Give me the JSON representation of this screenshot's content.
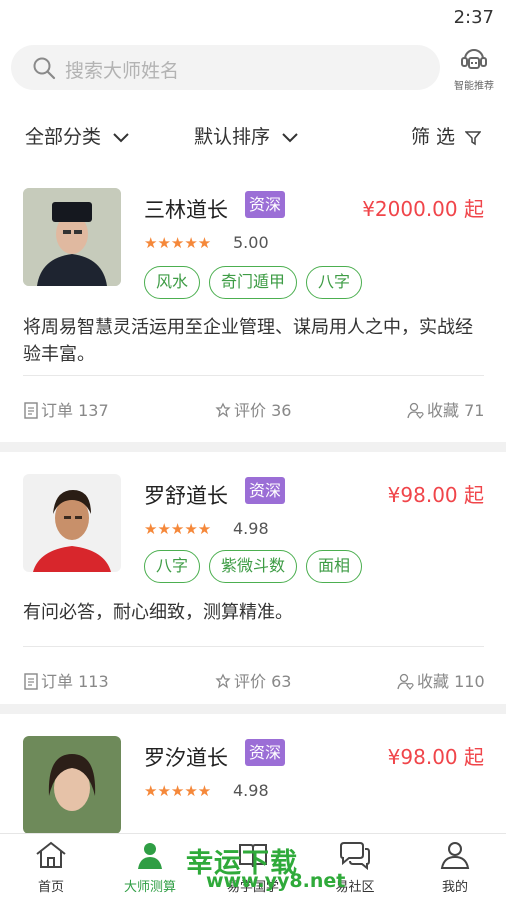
{
  "status_bar": {
    "time": "2:37"
  },
  "search": {
    "placeholder": "搜索大师姓名",
    "smart_label": "智能推荐"
  },
  "filters": {
    "category": "全部分类",
    "sort": "默认排序",
    "filter": "筛 选"
  },
  "masters": [
    {
      "name": "三林道长",
      "badge": "资深",
      "price": "¥2000.00 起",
      "stars": "★★★★★",
      "rating": "5.00",
      "tags": [
        "风水",
        "奇门遁甲",
        "八字"
      ],
      "description": "将周易智慧灵活运用至企业管理、谋局用人之中，实战经验丰富。",
      "orders": "订单 137",
      "reviews": "评价 36",
      "favorites": "收藏 71"
    },
    {
      "name": "罗舒道长",
      "badge": "资深",
      "price": "¥98.00 起",
      "stars": "★★★★★",
      "rating": "4.98",
      "tags": [
        "八字",
        "紫微斗数",
        "面相"
      ],
      "description": "有问必答，耐心细致，测算精准。",
      "orders": "订单 113",
      "reviews": "评价 63",
      "favorites": "收藏 110"
    },
    {
      "name": "罗汐道长",
      "badge": "资深",
      "price": "¥98.00 起",
      "stars": "★★★★★",
      "rating": "4.98"
    }
  ],
  "tabbar": {
    "home": "首页",
    "masters": "大师测算",
    "learn": "易学国学",
    "community": "易社区",
    "mine": "我的"
  },
  "watermark": {
    "line1": "幸运下载",
    "line2": "www.yy8.net"
  }
}
